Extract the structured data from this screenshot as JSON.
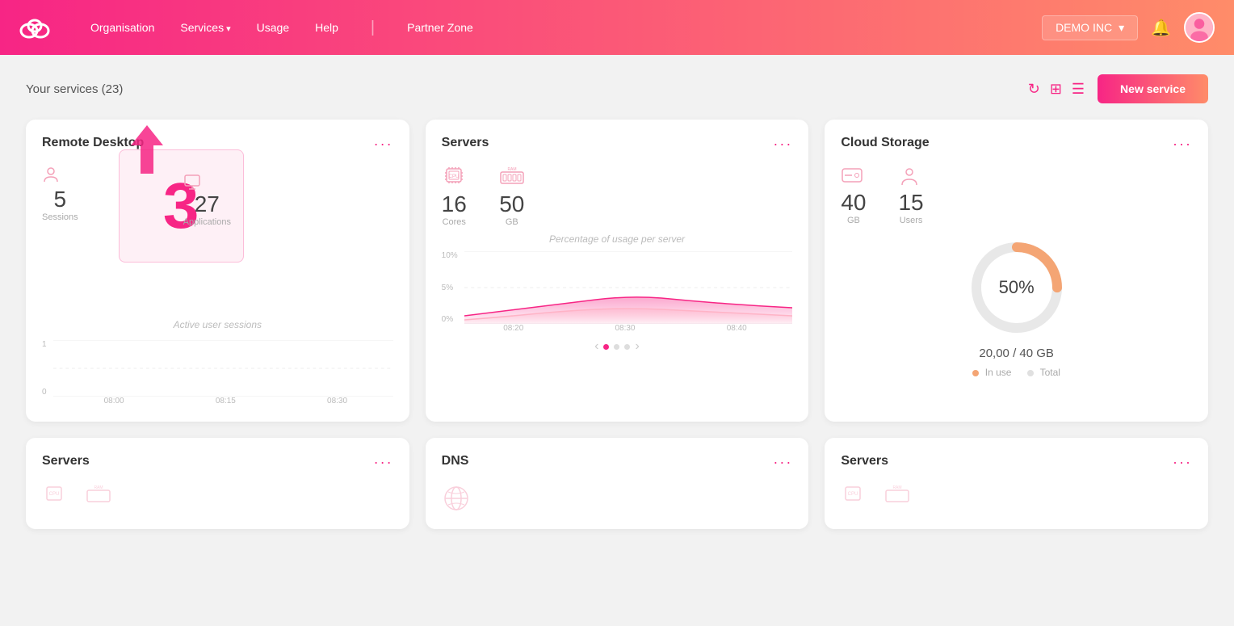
{
  "navbar": {
    "logo": "☁",
    "links": [
      {
        "label": "Organisation",
        "arrow": false
      },
      {
        "label": "Services",
        "arrow": true
      },
      {
        "label": "Usage",
        "arrow": false
      },
      {
        "label": "Help",
        "arrow": false
      },
      {
        "label": "Partner Zone",
        "arrow": false
      }
    ],
    "company": "DEMO INC",
    "bell": "🔔"
  },
  "services": {
    "title": "Your services (23)",
    "new_service_label": "New service"
  },
  "remote_desktop": {
    "title": "Remote Desktop",
    "menu": "···",
    "sessions_count": "5",
    "sessions_label": "Sessions",
    "applications_count": "27",
    "applications_label": "Applications",
    "big_number": "3",
    "subtitle": "Active user sessions",
    "chart_times": [
      "08:00",
      "08:15",
      "08:30"
    ],
    "y_labels": [
      "1",
      "0"
    ]
  },
  "servers_card": {
    "title": "Servers",
    "menu": "···",
    "cores": "16",
    "cores_label": "Cores",
    "gb": "50",
    "gb_label": "GB",
    "subtitle": "Percentage of usage per server",
    "chart_times": [
      "08:20",
      "08:30",
      "08:40"
    ],
    "y_labels": [
      "10%",
      "5%",
      "0%"
    ]
  },
  "cloud_storage": {
    "title": "Cloud Storage",
    "menu": "···",
    "gb": "40",
    "gb_label": "GB",
    "users": "15",
    "users_label": "Users",
    "percent": "50%",
    "total_text": "20,00 / 40 GB",
    "legend_in_use": "In use",
    "legend_total": "Total",
    "in_use_color": "#f4a574",
    "total_color": "#e0e0e0"
  },
  "bottom_cards": [
    {
      "title": "Servers",
      "menu": "···"
    },
    {
      "title": "DNS",
      "menu": "···"
    },
    {
      "title": "Servers",
      "menu": "···"
    }
  ]
}
